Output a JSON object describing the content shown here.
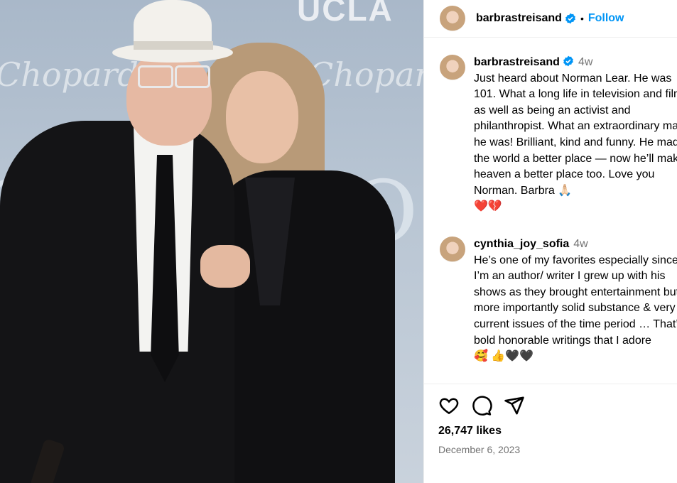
{
  "post_image": {
    "alt_text_visible": [
      "UCLA",
      "Chopard",
      "Chopard"
    ]
  },
  "header": {
    "username": "barbrastreisand",
    "separator": "•",
    "follow_label": "Follow"
  },
  "caption": {
    "username": "barbrastreisand",
    "age": "4w",
    "text": "Just heard about Norman Lear. He was 101. What a long life in television and film as well as being an activist and philanthropist. What an extraordinary man he was! Brilliant, kind and funny. He made the world a better place — now he’ll make heaven a better place too. Love you Norman. Barbra 🙏🏻",
    "hearts": "❤️💔"
  },
  "comments": [
    {
      "username": "cynthia_joy_sofia",
      "age": "4w",
      "text": "He’s one of my favorites especially since I’m an author/ writer I grew up with his shows as they brought entertainment but more importantly solid substance & very current issues of the time period … That’s bold honorable writings that I adore",
      "emoji": "🥰 👍🖤🖤"
    }
  ],
  "likes": "26,747 likes",
  "date": "December 6, 2023",
  "colors": {
    "link_blue": "#0095f6",
    "muted": "#737373",
    "heart_red": "#e0242b"
  }
}
